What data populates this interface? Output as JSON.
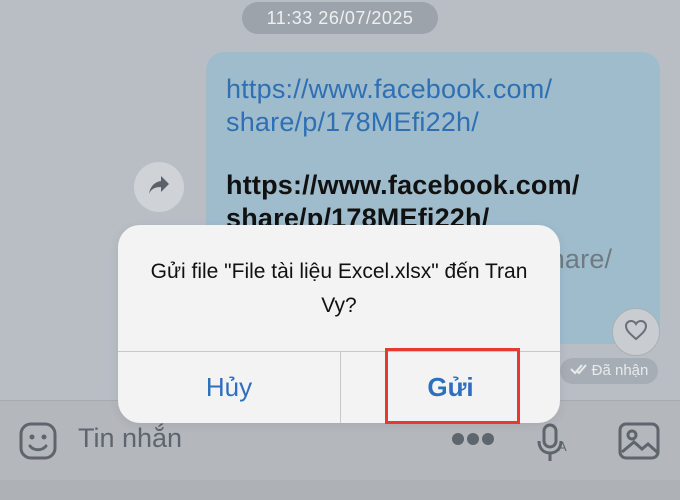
{
  "chat": {
    "timestamp": "11:33 26/07/2025",
    "message": {
      "link_line1": "https://www.facebook.com/",
      "link_line2": "share/p/178MEfi22h/",
      "bold_line1": "https://www.facebook.com/",
      "bold_line2": "share/p/178MEfi22h/",
      "partial_line": "share/"
    },
    "status": "Đã nhận"
  },
  "composer": {
    "placeholder": "Tin nhắn"
  },
  "dialog": {
    "message": "Gửi file \"File tài liệu Excel.xlsx\" đến Tran Vy?",
    "cancel_label": "Hủy",
    "send_label": "Gửi"
  },
  "colors": {
    "accent": "#2e6fbd",
    "highlight": "#e53935",
    "bubble": "#9fbccd"
  },
  "icons": [
    "share-icon",
    "heart-icon",
    "check-icon",
    "emoji-icon",
    "more-icon",
    "mic-icon",
    "image-icon"
  ]
}
